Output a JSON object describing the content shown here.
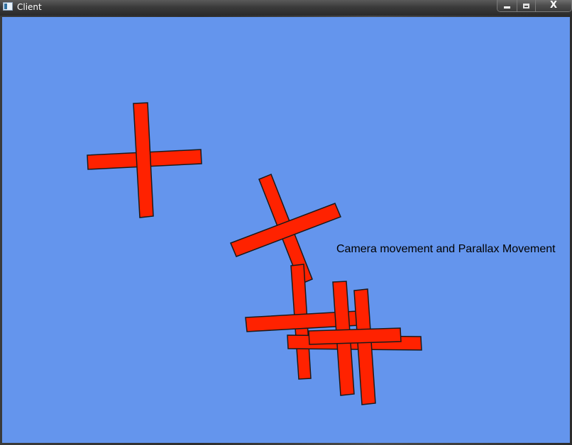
{
  "window": {
    "title": "Client",
    "icon": "application-window-icon",
    "caption_buttons": {
      "minimize_glyph": "▬",
      "maximize_glyph": "□",
      "close_glyph": "X"
    }
  },
  "scene": {
    "background_color": "#6495ED",
    "shape_fill": "#FF2200",
    "shape_stroke": "#1a1a1a",
    "caption": "Camera movement and Parallax Movement"
  }
}
